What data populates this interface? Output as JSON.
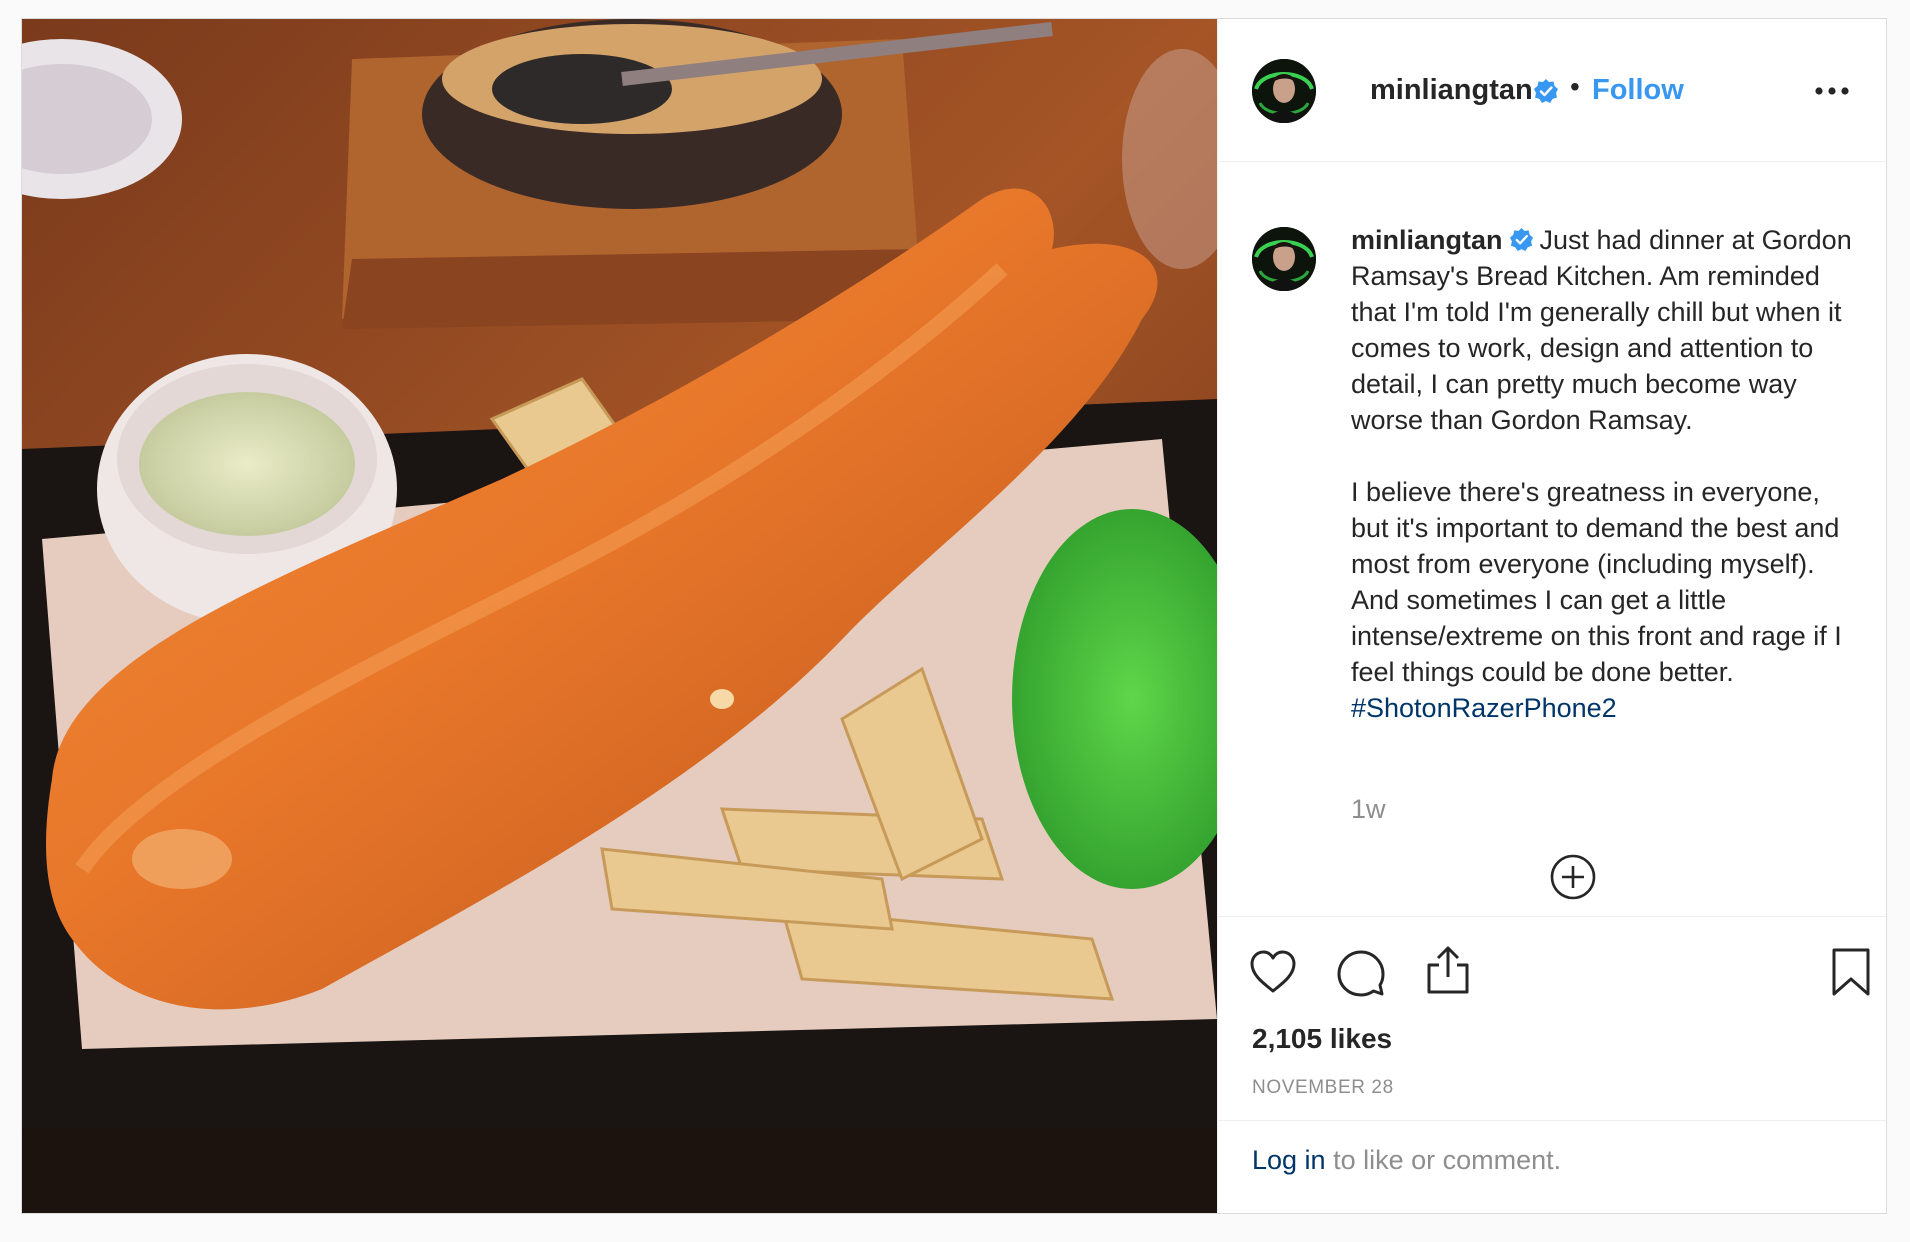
{
  "post": {
    "photo_alt": "",
    "author": {
      "username": "minliangtan",
      "verified": true,
      "follow_label": "Follow",
      "separator": "•"
    },
    "caption": {
      "username": "minliangtan",
      "text_part1": "Just had dinner at Gordon Ramsay's Bread Kitchen. Am reminded that I'm told I'm generally chill but when it comes to work, design and attention to detail, I can pretty much become way worse than Gordon Ramsay.\n\nI believe there's greatness in everyone, but it's important to demand the best and most from everyone (including myself). And sometimes I can get a little intense/extreme on this front and rage if I feel things could be done better. ",
      "hashtag": "#ShotonRazerPhone2"
    },
    "time_ago": "1w",
    "likes": "2,105 likes",
    "date": "NOVEMBER 28",
    "login_prompt": {
      "link_text": "Log in",
      "rest_text": " to like or comment."
    },
    "icons": {
      "like": "heart-icon",
      "comment": "comment-icon",
      "share": "share-icon",
      "save": "bookmark-icon",
      "more": "more-options-icon",
      "load_more": "plus-circle-icon",
      "verified": "verified-badge-icon"
    },
    "colors": {
      "link_blue": "#3897f0",
      "hashtag_navy": "#003569",
      "text": "#262626",
      "muted": "#8e8e8e",
      "verified_blue": "#3897f0"
    }
  }
}
